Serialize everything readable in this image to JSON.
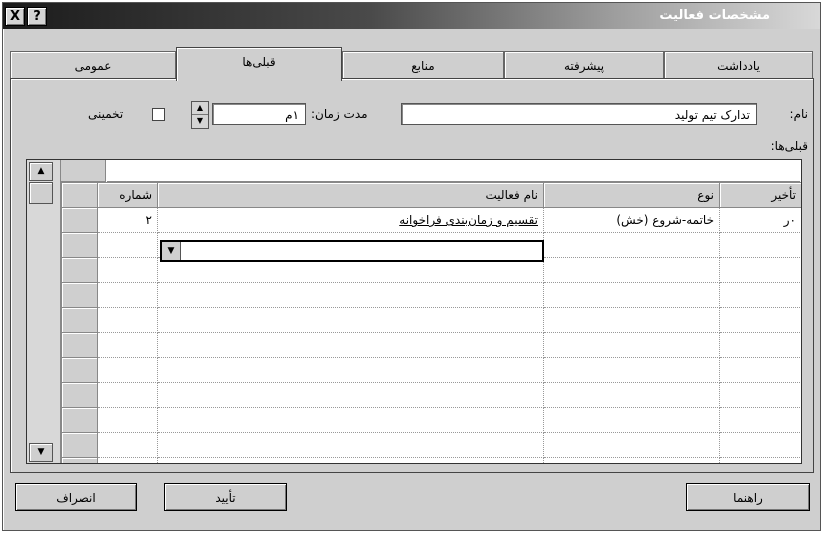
{
  "window": {
    "title": "مشخصات فعالیت",
    "help_label": "?",
    "close_label": "X"
  },
  "tabs": [
    {
      "label": "عمومی"
    },
    {
      "label": "قبلی‌ها"
    },
    {
      "label": "منابع"
    },
    {
      "label": "پیشرفته"
    },
    {
      "label": "یادداشت"
    }
  ],
  "active_tab": "قبلی‌ها",
  "form": {
    "name_label": "نام:",
    "name_value": "تدارک تیم تولید",
    "duration_label": "مدت زمان:",
    "duration_value": "۱م",
    "estimated_label": "تخمینی",
    "estimated_checked": false,
    "predecessors_label": "قبلی‌ها:"
  },
  "grid": {
    "columns": [
      "تأخیر",
      "نوع",
      "نام فعالیت",
      "شماره"
    ],
    "rows": [
      {
        "lag": "۰ر",
        "type": "خاتمه-شروع (خش)",
        "name": "تقسیم و زمان‌بندی فراخوانه",
        "id": "۲"
      }
    ]
  },
  "buttons": {
    "help": "راهنما",
    "ok": "تأیید",
    "cancel": "انصراف"
  }
}
